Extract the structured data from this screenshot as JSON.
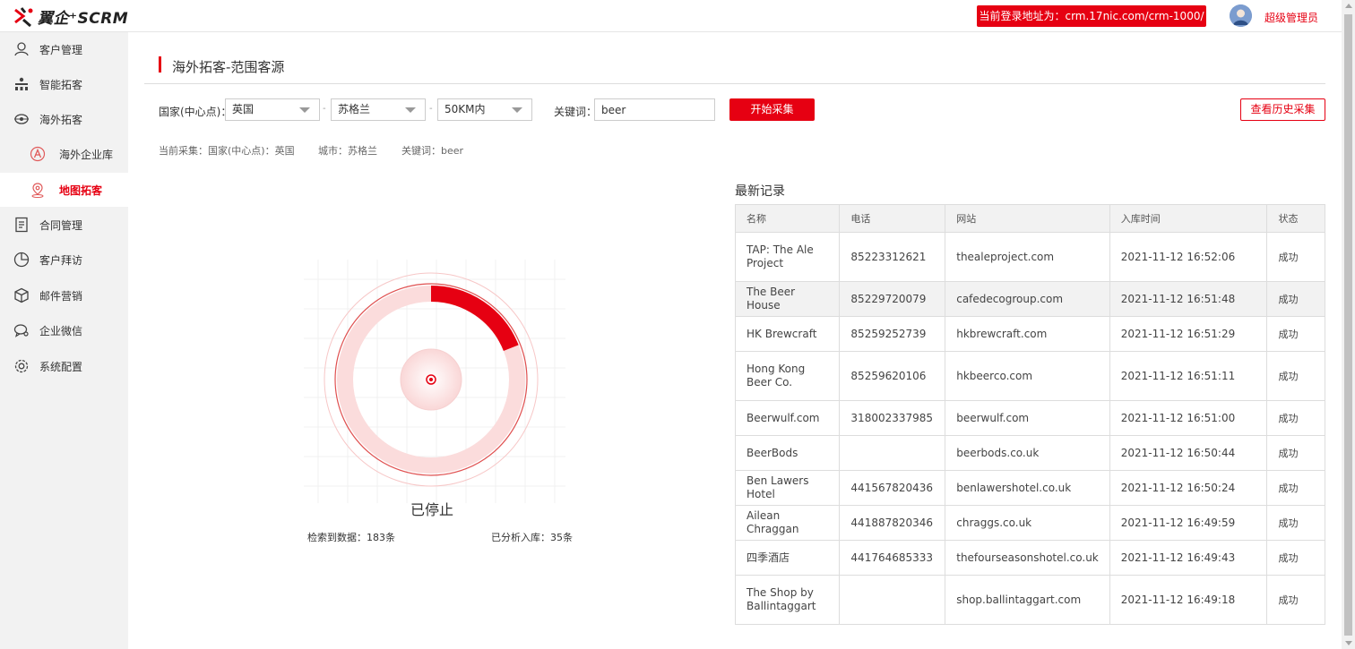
{
  "app": {
    "logo_text": "翼企⁺SCRM",
    "login_address": "当前登录地址为：crm.17nic.com/crm-1000/",
    "user_name": "超级管理员"
  },
  "sidebar": {
    "items": [
      {
        "label": "客户管理",
        "icon": "user-icon"
      },
      {
        "label": "智能拓客",
        "icon": "org-chart-icon"
      },
      {
        "label": "海外拓客",
        "icon": "globe-icon"
      },
      {
        "label": "海外企业库",
        "icon": "a-circle-icon"
      },
      {
        "label": "地图拓客",
        "icon": "map-pin-icon"
      },
      {
        "label": "合同管理",
        "icon": "document-icon"
      },
      {
        "label": "客户拜访",
        "icon": "pie-icon"
      },
      {
        "label": "邮件营销",
        "icon": "cube-icon"
      },
      {
        "label": "企业微信",
        "icon": "chat-icon"
      },
      {
        "label": "系统配置",
        "icon": "settings-icon"
      }
    ]
  },
  "main": {
    "page_title": "海外拓客-范围客源",
    "filters": {
      "country_label": "国家(中心点)：",
      "country_value": "英国",
      "city_value": "苏格兰",
      "range_value": "50KM内",
      "separator": "-",
      "keyword_label": "关键词：",
      "keyword_value": "beer",
      "start_button": "开始采集",
      "history_button": "查看历史采集"
    },
    "current": {
      "country": "当前采集：国家(中心点)：英国",
      "city": "城市：苏格兰",
      "keyword": "关键词：beer"
    },
    "radar": {
      "status": "已停止",
      "progress": 0.19,
      "found_label": "检索到数据：183条",
      "stored_label": "已分析入库：35条"
    },
    "records": {
      "title": "最新记录",
      "columns": [
        "名称",
        "电话",
        "网站",
        "入库时间",
        "状态"
      ],
      "rows": [
        [
          "TAP: The Ale Project",
          "85223312621",
          "thealeproject.com",
          "2021-11-12 16:52:06",
          "成功"
        ],
        [
          "The Beer House",
          "85229720079",
          "cafedecogroup.com",
          "2021-11-12 16:51:48",
          "成功"
        ],
        [
          "HK Brewcraft",
          "85259252739",
          "hkbrewcraft.com",
          "2021-11-12 16:51:29",
          "成功"
        ],
        [
          "Hong Kong Beer Co.",
          "85259620106",
          "hkbeerco.com",
          "2021-11-12 16:51:11",
          "成功"
        ],
        [
          "Beerwulf.com",
          "318002337985",
          "beerwulf.com",
          "2021-11-12 16:51:00",
          "成功"
        ],
        [
          "BeerBods",
          "",
          "beerbods.co.uk",
          "2021-11-12 16:50:44",
          "成功"
        ],
        [
          "Ben Lawers Hotel",
          "441567820436",
          "benlawershotel.co.uk",
          "2021-11-12 16:50:24",
          "成功"
        ],
        [
          "Ailean Chraggan",
          "441887820346",
          "chraggs.co.uk",
          "2021-11-12 16:49:59",
          "成功"
        ],
        [
          "四季酒店",
          "441764685333",
          "thefourseasonshotel.co.uk",
          "2021-11-12 16:49:43",
          "成功"
        ],
        [
          "The Shop by Ballintaggart",
          "",
          "shop.ballintaggart.com",
          "2021-11-12 16:49:18",
          "成功"
        ]
      ]
    }
  },
  "colors": {
    "accent": "#e60012",
    "sidebar_bg": "#f2f2f2"
  }
}
